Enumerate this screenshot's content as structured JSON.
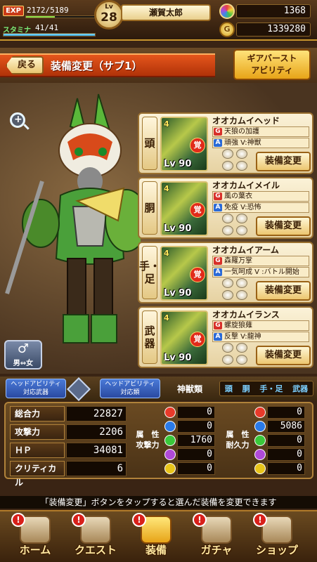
{
  "topbar": {
    "exp_label": "EXP",
    "exp_value": "2172/5189",
    "exp_fraction": 0.419,
    "stamina_label": "スタミナ",
    "stamina_value": "41/41",
    "stamina_fraction": 1.0,
    "level_prefix": "Lv",
    "level": "28",
    "player_name": "瀬賀太郎",
    "gems": "1368",
    "coins": "1339280"
  },
  "header": {
    "back_label": "戻る",
    "title": "装備変更（サブ1）",
    "gear_burst_label_1": "ギアバースト",
    "gear_burst_label_2": "アビリティ"
  },
  "gender": {
    "label": "男⇔女"
  },
  "slots": [
    {
      "label_1": "頭",
      "label_2": "",
      "name": "オオカムイヘッド",
      "ability_g": "天狼の加護",
      "ability_a": "頑強 V:神獣",
      "stars": "4",
      "awake": "覚",
      "level": "Lv 90",
      "change_label": "装備変更"
    },
    {
      "label_1": "胴",
      "label_2": "",
      "name": "オオカムイメイル",
      "ability_g": "風の葉衣",
      "ability_a": "免疫 V:恐怖",
      "stars": "4",
      "awake": "覚",
      "level": "Lv 90",
      "change_label": "装備変更"
    },
    {
      "label_1": "手・",
      "label_2": "足",
      "name": "オオカムイアーム",
      "ability_g": "森羅万掌",
      "ability_a": "一気呵成 V :バトル開始",
      "stars": "4",
      "awake": "覚",
      "level": "Lv 90",
      "change_label": "装備変更"
    },
    {
      "label_1": "武",
      "label_2": "器",
      "name": "オオカムイランス",
      "ability_g": "螺旋狼薙",
      "ability_a": "反撃 V:龍神",
      "stars": "4",
      "awake": "覚",
      "level": "Lv 90",
      "change_label": "装備変更"
    }
  ],
  "ability_header": {
    "weapon_tag_1": "ヘッドアビリティ",
    "weapon_tag_2": "対応武器",
    "type_tag_1": "ヘッドアビリティ",
    "type_tag_2": "対応類",
    "type_name": "神獣類",
    "parts": [
      "頭",
      "胴",
      "手・足",
      "武器"
    ]
  },
  "stats": [
    {
      "label": "総合力",
      "value": "22827"
    },
    {
      "label": "攻撃力",
      "value": "2206"
    },
    {
      "label": "ＨＰ",
      "value": "34081"
    },
    {
      "label": "クリティカル",
      "value": "6"
    }
  ],
  "elements": {
    "attack_label_1": "属　性",
    "attack_label_2": "攻撃力",
    "defense_label_1": "属　性",
    "defense_label_2": "耐久力",
    "colors": [
      "#e83a2a",
      "#2a7ae8",
      "#3ac83a",
      "#b04ad8",
      "#e8c41a"
    ],
    "attack": [
      "0",
      "0",
      "1760",
      "0",
      "0"
    ],
    "defense": [
      "0",
      "5086",
      "0",
      "0",
      "0"
    ]
  },
  "help_text": "「装備変更」ボタンをタップすると選んだ装備を変更できます",
  "nav": [
    {
      "label": "ホーム",
      "alert": "!"
    },
    {
      "label": "クエスト",
      "alert": "!"
    },
    {
      "label": "装備",
      "alert": "!"
    },
    {
      "label": "ガチャ",
      "alert": "!"
    },
    {
      "label": "ショップ",
      "alert": "!"
    }
  ]
}
